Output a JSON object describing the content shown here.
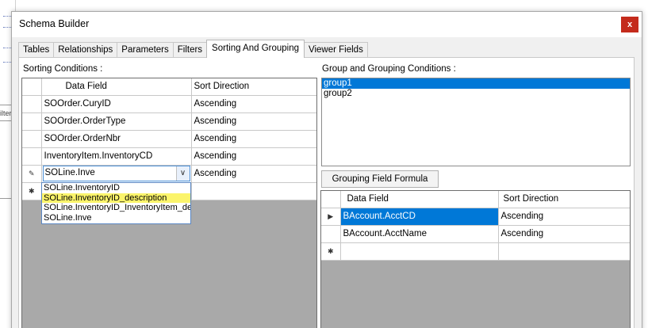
{
  "window": {
    "title": "Schema Builder",
    "close_label": "x"
  },
  "tabs": [
    {
      "label": "Tables"
    },
    {
      "label": "Relationships"
    },
    {
      "label": "Parameters"
    },
    {
      "label": "Filters"
    },
    {
      "label": "Sorting And Grouping"
    },
    {
      "label": "Viewer Fields"
    }
  ],
  "active_tab": "Sorting And Grouping",
  "background_fragment": "ilter",
  "sorting": {
    "label": "Sorting Conditions :",
    "columns": [
      "Data Field",
      "Sort Direction"
    ],
    "rows": [
      {
        "field": "SOOrder.CuryID",
        "direction": "Ascending"
      },
      {
        "field": "SOOrder.OrderType",
        "direction": "Ascending"
      },
      {
        "field": "SOOrder.OrderNbr",
        "direction": "Ascending"
      },
      {
        "field": "InventoryItem.InventoryCD",
        "direction": "Ascending"
      }
    ],
    "editing_row": {
      "marker": "✎",
      "field_value": "SOLine.Inve",
      "direction": "Ascending"
    },
    "new_row_marker": "✱",
    "dropdown_options": [
      "SOLine.InventoryID",
      "SOLine.InventoryID_description",
      "SOLine.InventoryID_InventoryItem_description",
      "SOLine.Inve"
    ],
    "dropdown_highlighted_index": 1
  },
  "grouping": {
    "label": "Group and Grouping Conditions :",
    "groups": [
      "group1",
      "group2"
    ],
    "selected_group_index": 0,
    "formula_button": "Grouping Field Formula",
    "columns": [
      "Data Field",
      "Sort Direction"
    ],
    "rows": [
      {
        "marker": "▶",
        "field": "BAccount.AcctCD",
        "direction": "Ascending",
        "selected": true
      },
      {
        "marker": "",
        "field": "BAccount.AcctName",
        "direction": "Ascending",
        "selected": false
      }
    ],
    "new_row_marker": "✱"
  },
  "colors": {
    "selection": "#0078d7",
    "highlight": "#fbf46b",
    "close": "#c42b1c"
  }
}
